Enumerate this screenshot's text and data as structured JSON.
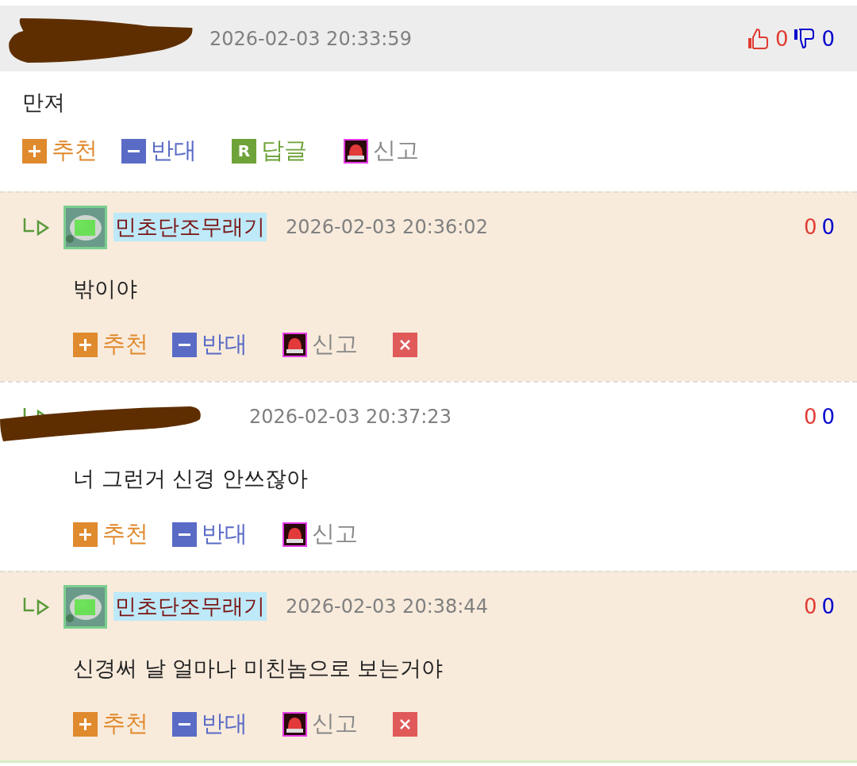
{
  "comments": [
    {
      "kind": "top",
      "shaded": false,
      "redacted": true,
      "date": "2026-02-03 20:33:59",
      "up": "0",
      "down": "0",
      "body": "만져",
      "actions": [
        {
          "kind": "recommend",
          "label": "추천"
        },
        {
          "kind": "oppose",
          "label": "반대"
        },
        {
          "kind": "reply",
          "label": "답글",
          "icon_text": "R"
        },
        {
          "kind": "report",
          "label": "신고"
        }
      ]
    },
    {
      "kind": "reply",
      "shaded": true,
      "redacted": false,
      "author": "민초단조무래기",
      "author_highlighted": true,
      "date": "2026-02-03 20:36:02",
      "up": "0",
      "down": "0",
      "body": "밖이야",
      "actions": [
        {
          "kind": "recommend",
          "label": "추천"
        },
        {
          "kind": "oppose",
          "label": "반대"
        },
        {
          "kind": "report",
          "label": "신고"
        },
        {
          "kind": "delete"
        }
      ]
    },
    {
      "kind": "reply",
      "shaded": false,
      "redacted": true,
      "date": "2026-02-03 20:37:23",
      "up": "0",
      "down": "0",
      "body": "너 그런거 신경 안쓰잖아",
      "actions": [
        {
          "kind": "recommend",
          "label": "추천"
        },
        {
          "kind": "oppose",
          "label": "반대"
        },
        {
          "kind": "report",
          "label": "신고"
        }
      ]
    },
    {
      "kind": "reply",
      "shaded": true,
      "redacted": false,
      "author": "민초단조무래기",
      "author_highlighted": true,
      "date": "2026-02-03 20:38:44",
      "up": "0",
      "down": "0",
      "body": "신경써 날 얼마나 미친놈으로 보는거야",
      "actions": [
        {
          "kind": "recommend",
          "label": "추천"
        },
        {
          "kind": "oppose",
          "label": "반대"
        },
        {
          "kind": "report",
          "label": "신고"
        },
        {
          "kind": "delete"
        }
      ]
    }
  ]
}
